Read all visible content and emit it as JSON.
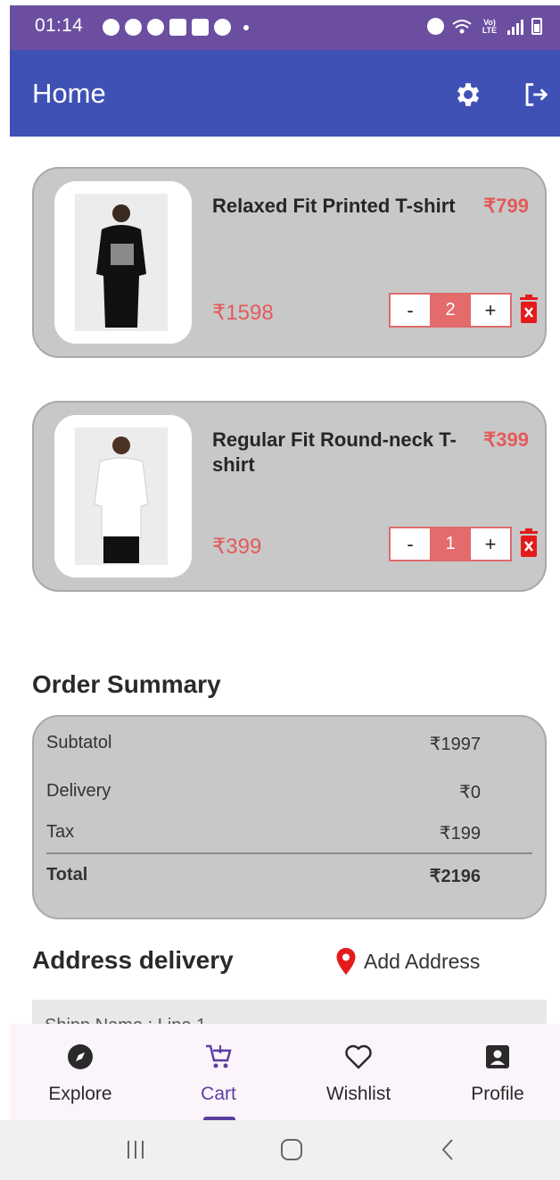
{
  "status_bar": {
    "time": "01:14",
    "lte_label": "Vo) LTE"
  },
  "app_bar": {
    "title": "Home",
    "actions": [
      "settings-icon",
      "logout-icon"
    ],
    "color": "#3f51b5"
  },
  "cart": {
    "items": [
      {
        "name": "Relaxed Fit Printed T-shirt",
        "unit_price": "₹799",
        "line_total": "₹1598",
        "quantity": "2",
        "decrement_label": "-",
        "increment_label": "+"
      },
      {
        "name": "Regular Fit Round-neck T-shirt",
        "unit_price": "₹399",
        "line_total": "₹399",
        "quantity": "1",
        "decrement_label": "-",
        "increment_label": "+"
      }
    ]
  },
  "order_summary": {
    "title": "Order Summary",
    "rows": [
      {
        "label": "Subtatol",
        "value": "₹1997"
      },
      {
        "label": "Delivery",
        "value": "₹0"
      },
      {
        "label": "Tax",
        "value": "₹199"
      }
    ],
    "total": {
      "label": "Total",
      "value": "₹2196"
    }
  },
  "address": {
    "title": "Address delivery",
    "add_label": "Add Address",
    "peek_text": "Shipp      Name :   Line 1"
  },
  "bottom_nav": {
    "items": [
      {
        "label": "Explore",
        "icon": "compass-icon"
      },
      {
        "label": "Cart",
        "icon": "cart-icon",
        "active": true
      },
      {
        "label": "Wishlist",
        "icon": "heart-icon"
      },
      {
        "label": "Profile",
        "icon": "profile-icon"
      }
    ]
  },
  "colors": {
    "accent": "#5b3fa0",
    "price": "#e35b5b",
    "card": "#c8c8c8"
  }
}
